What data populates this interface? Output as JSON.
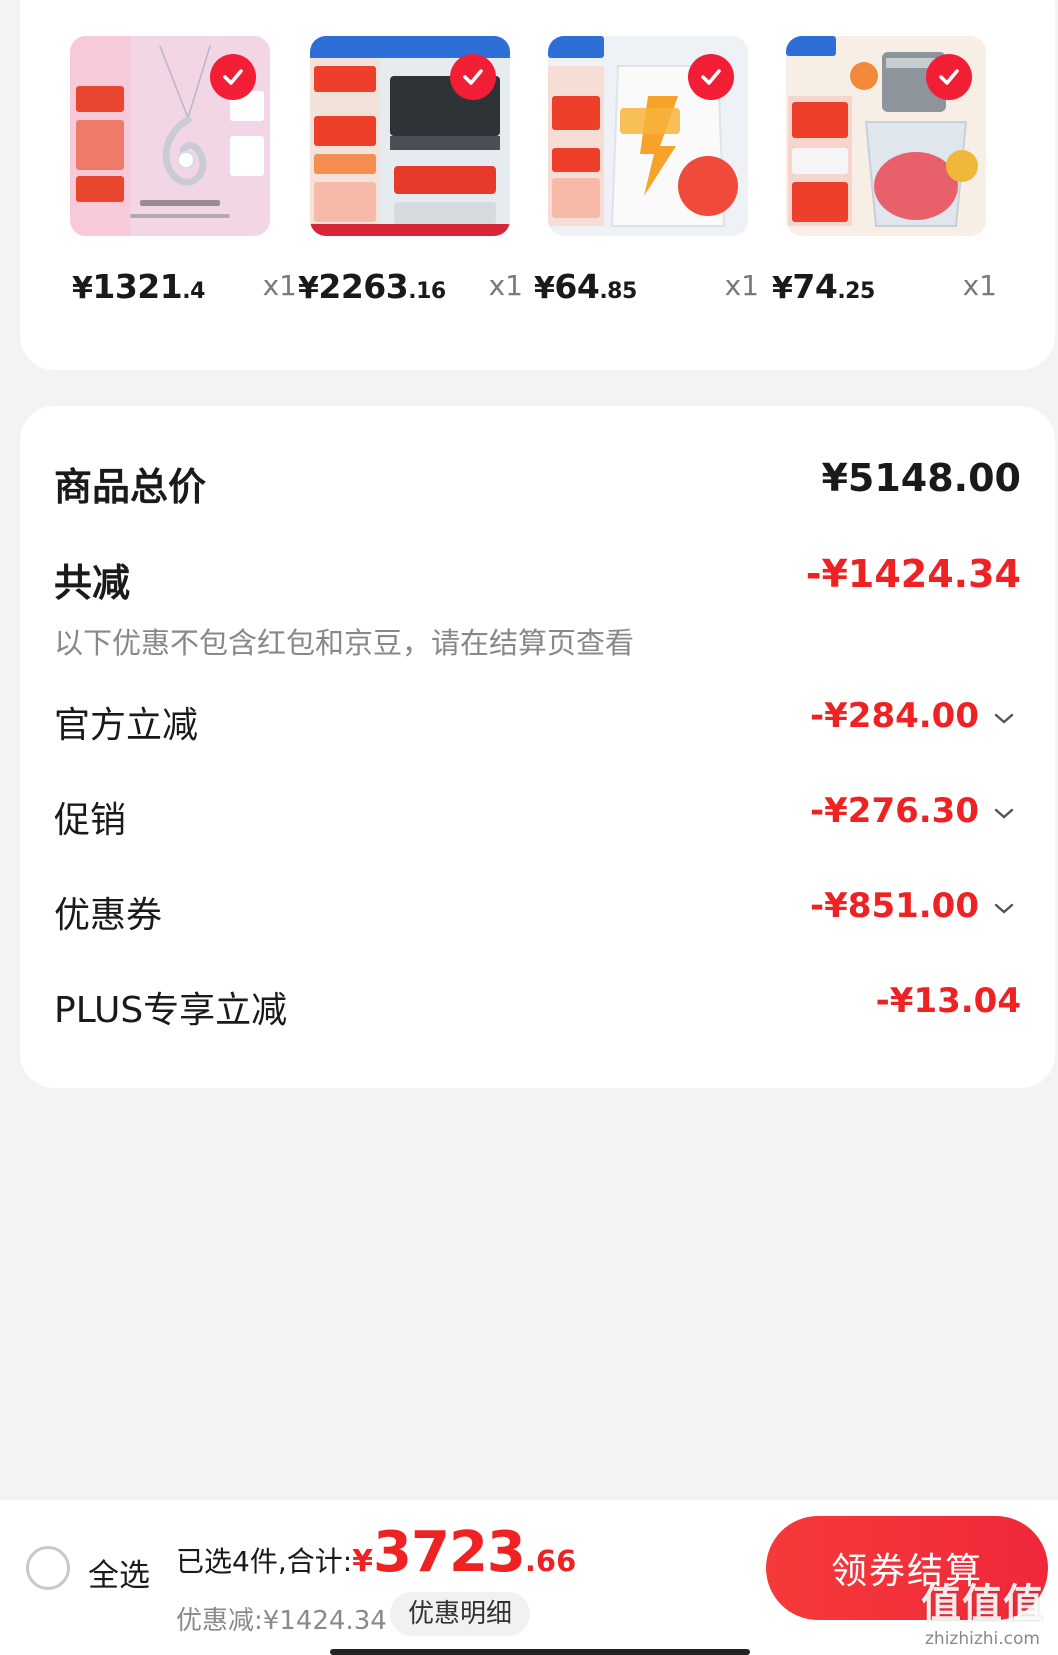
{
  "products": [
    {
      "name": "pendant-necklace",
      "price_currency": "¥",
      "price_int": "1321",
      "price_dec": ".4",
      "qty": "x1",
      "thumb_bg": "#f4dbe8"
    },
    {
      "name": "range-hood",
      "price_currency": "¥",
      "price_int": "2263",
      "price_dec": ".16",
      "qty": "x1",
      "thumb_bg": "#e9edf2"
    },
    {
      "name": "electric-kettle",
      "price_currency": "¥",
      "price_int": "64",
      "price_dec": ".85",
      "qty": "x1",
      "thumb_bg": "#eef3f7"
    },
    {
      "name": "food-chopper",
      "price_currency": "¥",
      "price_int": "74",
      "price_dec": ".25",
      "qty": "x1",
      "thumb_bg": "#f6eee6"
    }
  ],
  "summary": {
    "total_label": "商品总价",
    "total_value": "¥5148.00",
    "reduce_label": "共减",
    "reduce_value": "-¥1424.34",
    "note": "以下优惠不包含红包和京豆，请在结算页查看",
    "items": [
      {
        "label": "官方立减",
        "value": "-¥284.00",
        "expandable": true
      },
      {
        "label": "促销",
        "value": "-¥276.30",
        "expandable": true
      },
      {
        "label": "优惠券",
        "value": "-¥851.00",
        "expandable": true
      },
      {
        "label": "PLUS专享立减",
        "value": "-¥13.04",
        "expandable": false
      }
    ]
  },
  "bottom": {
    "select_all": "全选",
    "selected_text": "已选4件,合计:",
    "total_currency": "¥",
    "total_int": "3723",
    "total_dec": ".66",
    "discount_text": "优惠减:¥1424.34",
    "detail_button": "优惠明细",
    "checkout_button": "领券结算"
  },
  "watermark": {
    "mark": "值值值",
    "url": "zhizhizhi.com"
  },
  "colors": {
    "accent": "#ee2222",
    "check": "#f11e35",
    "background": "#f3f3f3"
  }
}
